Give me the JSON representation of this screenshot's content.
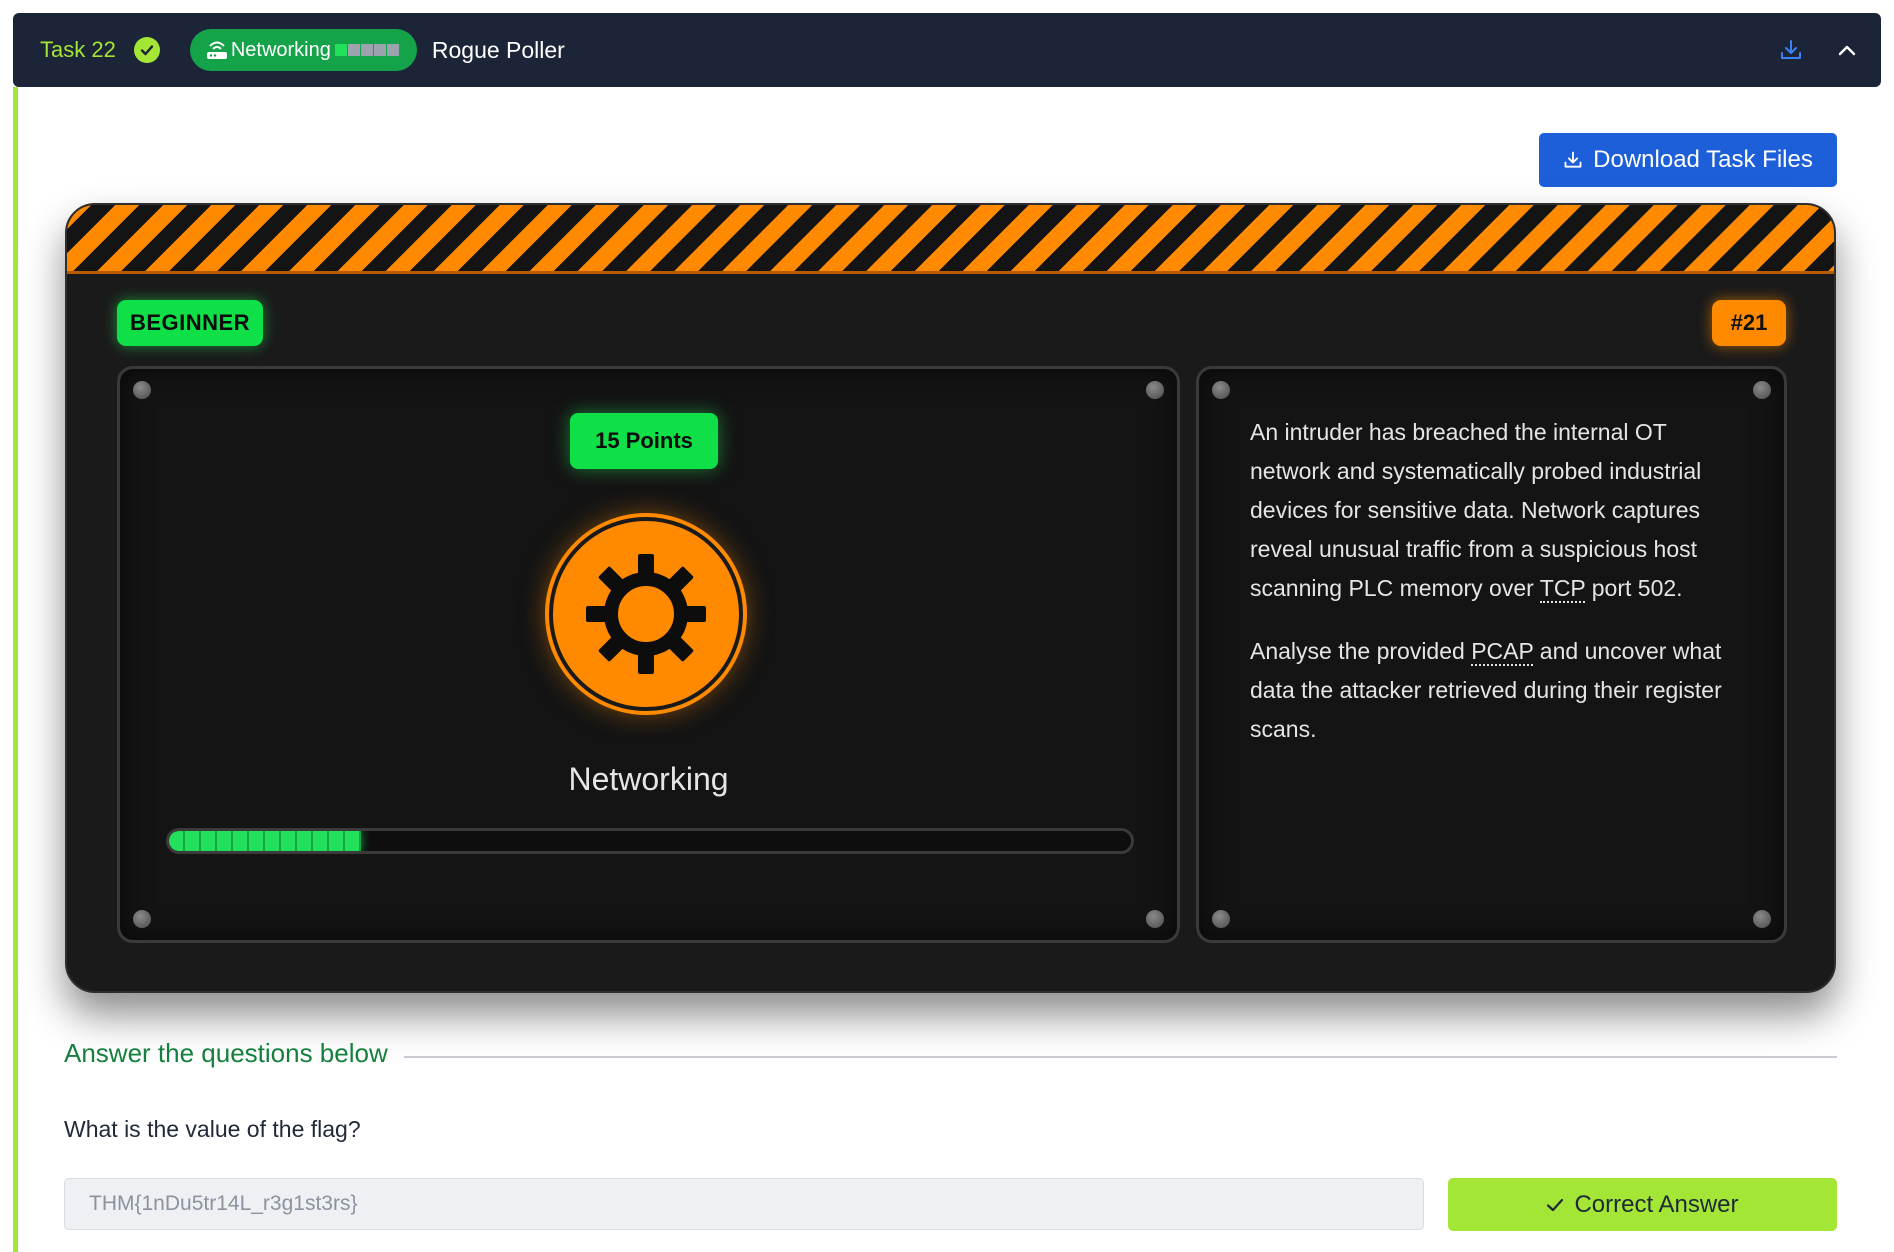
{
  "task": {
    "label": "Task 22",
    "completed": true,
    "category_pill": "Networking",
    "difficulty_bars_on": 1,
    "difficulty_bars_total": 5,
    "title": "Rogue Poller",
    "download_icon": "download-icon",
    "collapse_icon": "chevron-up-icon"
  },
  "download_button": {
    "label": "Download Task Files",
    "icon": "download-icon"
  },
  "card": {
    "difficulty": "BEGINNER",
    "number": "#21",
    "points": "15 Points",
    "category_icon": "gear-icon",
    "category": "Networking",
    "progress": 0.2,
    "description": [
      [
        "An intruder has breached the internal OT network and systematically probed industrial devices for sensitive data. Network captures reveal unusual traffic from a suspicious host scanning PLC memory over ",
        "TCP",
        " port 502."
      ],
      [
        "Analyse the provided ",
        "PCAP",
        " and uncover what data the attacker retrieved during their register scans."
      ]
    ]
  },
  "questions": {
    "heading": "Answer the questions below",
    "items": [
      {
        "question": "What is the value of the flag?",
        "answer": "THM{1nDu5tr14L_r3g1st3rs}",
        "button_label": "Correct Answer"
      }
    ]
  },
  "colors": {
    "header_bg": "#1c2438",
    "accent_green": "#a3e635",
    "hazard_orange": "#ff8a00",
    "primary_blue": "#1d5fd8",
    "badge_green": "#0fe048"
  }
}
